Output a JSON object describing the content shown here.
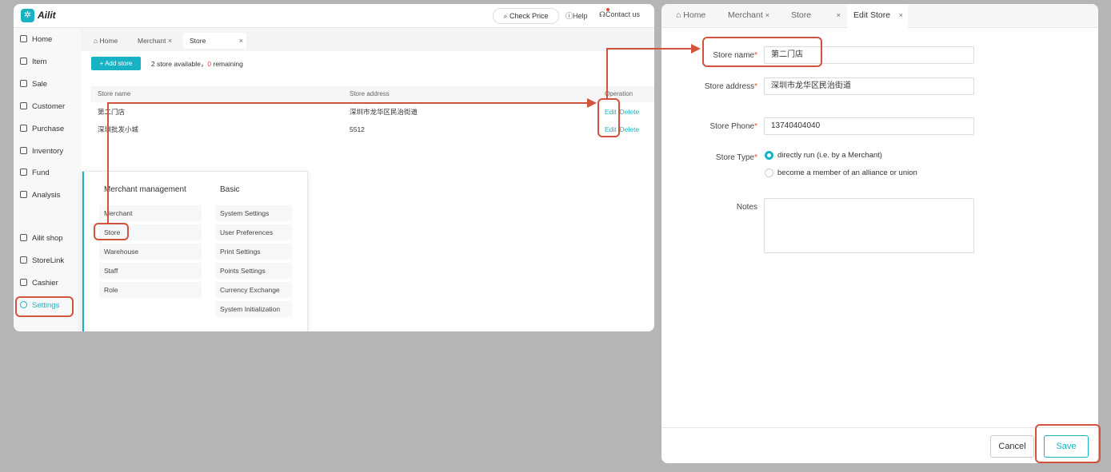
{
  "app": {
    "brand": "Ailit",
    "check_price": "Check Price",
    "help": "Help",
    "contact": "Contact us"
  },
  "sidebar": {
    "items": [
      {
        "label": "Home",
        "icon": "home-icon"
      },
      {
        "label": "Item",
        "icon": "item-icon"
      },
      {
        "label": "Sale",
        "icon": "sale-icon"
      },
      {
        "label": "Customer",
        "icon": "customer-icon"
      },
      {
        "label": "Purchase",
        "icon": "purchase-icon"
      },
      {
        "label": "Inventory",
        "icon": "inventory-icon"
      },
      {
        "label": "Fund",
        "icon": "fund-icon"
      },
      {
        "label": "Analysis",
        "icon": "analysis-icon"
      },
      {
        "label": "Ailit shop",
        "icon": "shop-icon"
      },
      {
        "label": "StoreLink",
        "icon": "storelink-icon"
      },
      {
        "label": "Cashier",
        "icon": "cashier-icon"
      },
      {
        "label": "Settings",
        "icon": "settings-icon"
      }
    ]
  },
  "left_tabs": {
    "home": "Home",
    "merchant": "Merchant",
    "store": "Store"
  },
  "store_page": {
    "add_button": "+ Add store",
    "availability_prefix": "2 store available，",
    "remaining_count": "0",
    "availability_suffix": " remaining",
    "columns": {
      "name": "Store name",
      "address": "Store address",
      "operation": "Operation"
    },
    "rows": [
      {
        "name": "第二门店",
        "address": "深圳市龙华区民治街道",
        "edit": "Edit",
        "delete": "Delete"
      },
      {
        "name": "深圳批发小城",
        "address": "5512",
        "edit": "Edit",
        "delete": "Delete"
      }
    ]
  },
  "settings_panel": {
    "merchant_heading": "Merchant management",
    "merchant_items": [
      "Merchant",
      "Store",
      "Warehouse",
      "Staff",
      "Role"
    ],
    "basic_heading": "Basic",
    "basic_items": [
      "System Settings",
      "User Preferences",
      "Print Settings",
      "Points Settings",
      "Currency Exchange",
      "System Initialization"
    ]
  },
  "right_tabs": {
    "home": "Home",
    "merchant": "Merchant",
    "store": "Store",
    "edit_store": "Edit Store"
  },
  "edit_form": {
    "store_name_label": "Store name",
    "store_name_value": "第二门店",
    "store_address_label": "Store address",
    "store_address_value": "深圳市龙华区民治街道",
    "store_phone_label": "Store Phone",
    "store_phone_value": "13740404040",
    "store_type_label": "Store Type",
    "type_option_1": "directly run (i.e. by a Merchant)",
    "type_option_2": "become a member of an alliance or union",
    "notes_label": "Notes",
    "cancel": "Cancel",
    "save": "Save"
  },
  "colors": {
    "accent": "#17b3c4",
    "annotation": "#d2533d",
    "required": "#e04a3a"
  }
}
